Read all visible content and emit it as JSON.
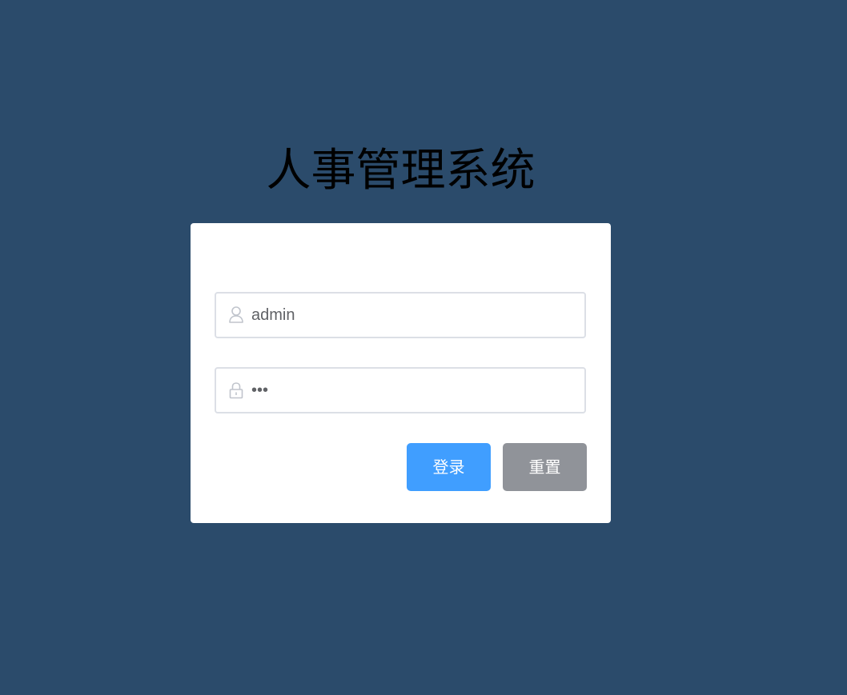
{
  "app": {
    "title": "人事管理系统"
  },
  "login_form": {
    "username": {
      "value": "admin",
      "icon": "user-icon"
    },
    "password": {
      "value": "•••",
      "icon": "lock-icon"
    },
    "buttons": {
      "login_label": "登录",
      "reset_label": "重置"
    }
  },
  "colors": {
    "background": "#2b4b6b",
    "primary": "#409eff",
    "secondary": "#909399",
    "border": "#dcdfe6"
  }
}
